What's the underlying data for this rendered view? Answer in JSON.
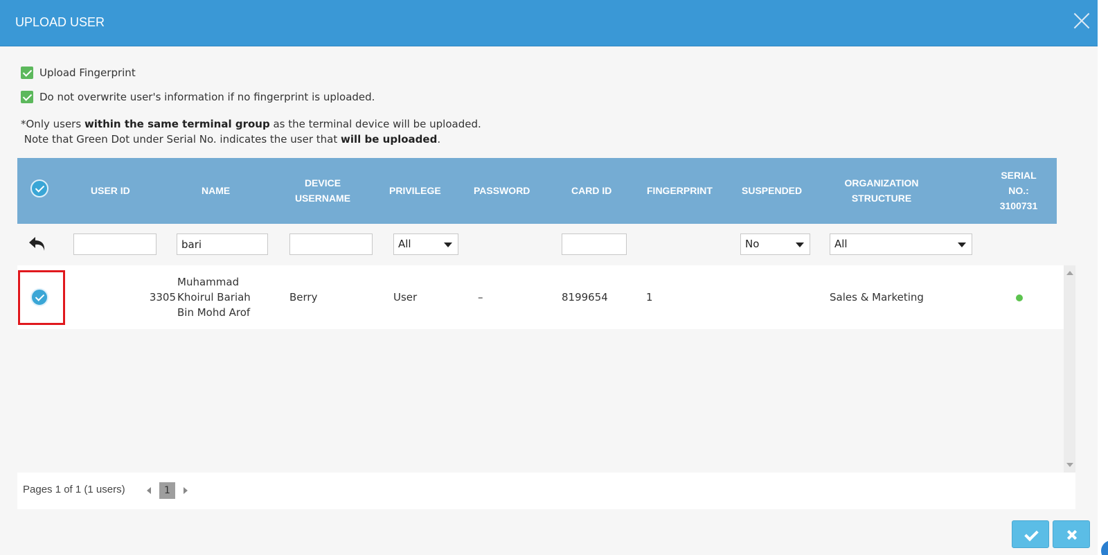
{
  "dialog": {
    "title": "UPLOAD USER"
  },
  "options": [
    {
      "label": "Upload Fingerprint",
      "checked": true
    },
    {
      "label": "Do not overwrite user's information if no fingerprint is uploaded.",
      "checked": true
    }
  ],
  "note": {
    "line1_a": "*Only users ",
    "line1_b": "within the same terminal group",
    "line1_c": " as the terminal device will be uploaded.",
    "line2_a": " Note that Green Dot under Serial No. indicates the user that ",
    "line2_b": "will be uploaded",
    "line2_c": "."
  },
  "table": {
    "headers": {
      "user_id": "USER ID",
      "name": "NAME",
      "device_username_1": "DEVICE",
      "device_username_2": "USERNAME",
      "privilege": "PRIVILEGE",
      "password": "PASSWORD",
      "card_id": "CARD ID",
      "fingerprint": "FINGERPRINT",
      "suspended": "SUSPENDED",
      "org_1": "ORGANIZATION",
      "org_2": "STRUCTURE",
      "serial_1": "SERIAL",
      "serial_2": "NO.:",
      "serial_3": "3100731"
    },
    "filters": {
      "user_id": "",
      "name": "bari",
      "device_username": "",
      "privilege": "All",
      "card_id": "",
      "suspended": "No",
      "org": "All"
    },
    "rows": [
      {
        "selected": true,
        "user_id": "3305",
        "name_1": "Muhammad",
        "name_2": "Khoirul Bariah",
        "name_3": "Bin Mohd Arof",
        "device_username": "Berry",
        "privilege": "User",
        "password": "–",
        "card_id": "8199654",
        "fingerprint": "1",
        "suspended": "",
        "org": "Sales & Marketing",
        "will_upload": true
      }
    ]
  },
  "pager": {
    "text": "Pages 1 of 1 (1 users)",
    "current": "1"
  },
  "colors": {
    "header": "#3a98d6",
    "table_header": "#75acd3",
    "button": "#5bbde6",
    "dot": "#5cc34e",
    "highlight": "#e0191e"
  },
  "icons": [
    "close-icon",
    "checkbox-checked-icon",
    "round-check-icon",
    "undo-icon",
    "caret-down-icon",
    "green-dot-icon",
    "check-icon",
    "times-icon"
  ]
}
